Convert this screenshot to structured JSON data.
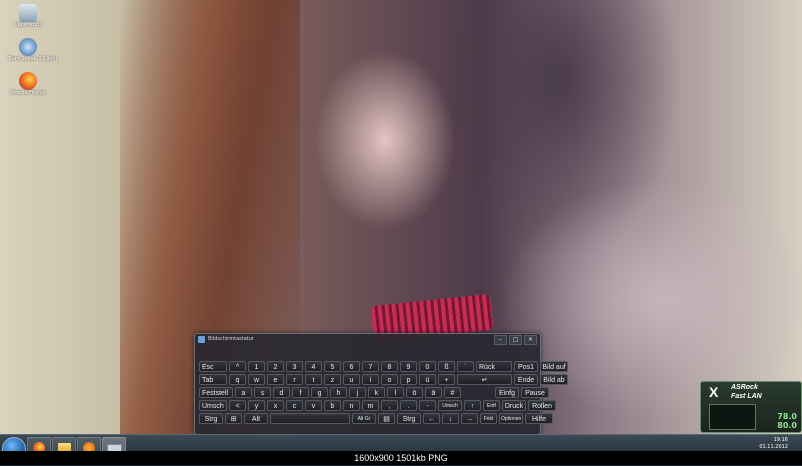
{
  "desktop": {
    "icons": [
      {
        "label": "Papierkorb",
        "icon": "recycle-bin-icon"
      },
      {
        "label": "TeamSpeak 3 Client",
        "icon": "teamspeak-icon"
      },
      {
        "label": "Mozilla Firefox",
        "icon": "firefox-icon"
      }
    ]
  },
  "osk": {
    "title": "Bildschirmtastatur",
    "controls": [
      "–",
      "□",
      "✕"
    ],
    "rows": [
      [
        "Esc",
        "^",
        "1",
        "2",
        "3",
        "4",
        "5",
        "6",
        "7",
        "8",
        "9",
        "0",
        "ß",
        "´",
        "Rück",
        "Pos1",
        "Bild auf"
      ],
      [
        "Tab",
        "q",
        "w",
        "e",
        "r",
        "t",
        "z",
        "u",
        "i",
        "o",
        "p",
        "ü",
        "+",
        "↵",
        "Ende",
        "Bild ab"
      ],
      [
        "Feststell",
        "a",
        "s",
        "d",
        "f",
        "g",
        "h",
        "j",
        "k",
        "l",
        "ö",
        "ä",
        "#",
        "Einfg",
        "Pause"
      ],
      [
        "Umsch",
        "<",
        "y",
        "x",
        "c",
        "v",
        "b",
        "n",
        "m",
        ",",
        ".",
        "-",
        "Umsch",
        "↑",
        "Entf",
        "Druck",
        "Rollen"
      ],
      [
        "Strg",
        "⊞",
        "Alt",
        "",
        "Alt Gr",
        "▤",
        "Strg",
        "←",
        "↓",
        "→",
        "Fnkt",
        "Optionen",
        "Hilfe"
      ]
    ]
  },
  "gadget": {
    "brand": "ASRock",
    "product": "Fast LAN",
    "logo": "X",
    "value1": "78.0",
    "value2": "80.0"
  },
  "taskbar": {
    "apps": [
      {
        "icon": "firefox-icon"
      },
      {
        "icon": "explorer-icon"
      },
      {
        "icon": "media-player-icon"
      },
      {
        "icon": "osk-icon"
      }
    ],
    "time": "19:16",
    "date": "01.11.2012"
  },
  "watermark": "1600x900  1501kb  PNG"
}
